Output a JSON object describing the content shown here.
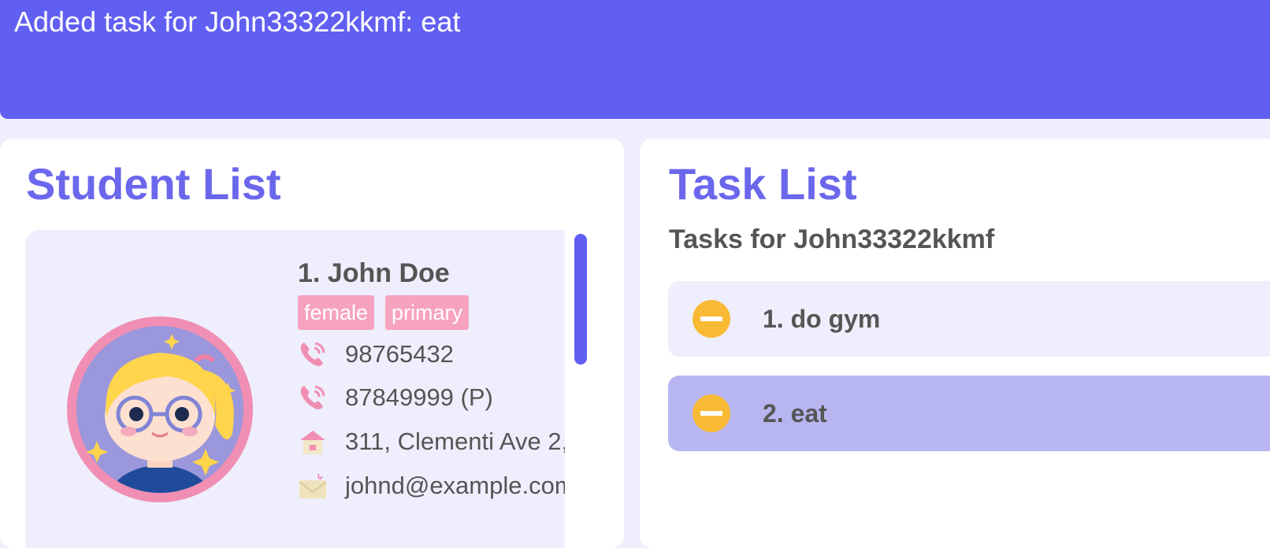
{
  "result_display": {
    "text": "Added task for John33322kkmf: eat"
  },
  "student_list": {
    "title": "Student List",
    "students": [
      {
        "index_name": "1.  John Doe",
        "tags": [
          "female",
          "primary"
        ],
        "phone": "98765432",
        "parent_phone": "87849999 (P)",
        "address": "311, Clementi Ave 2,",
        "email": "johnd@example.com",
        "avatar_icon": "girl-with-glasses-avatar-icon"
      }
    ]
  },
  "task_list": {
    "title": "Task List",
    "subtitle": "Tasks for John33322kkmf",
    "tasks": [
      {
        "label": "1. do gym",
        "status_icon": "minus-circle-icon"
      },
      {
        "label": "2. eat",
        "status_icon": "minus-circle-icon",
        "selected": true
      }
    ]
  },
  "colors": {
    "accent": "#615ff2",
    "title": "#6b67ec",
    "tag": "#f7a3bf",
    "status": "#f8b934",
    "selected_task": "#b8b6f0",
    "background": "#efeefc"
  }
}
